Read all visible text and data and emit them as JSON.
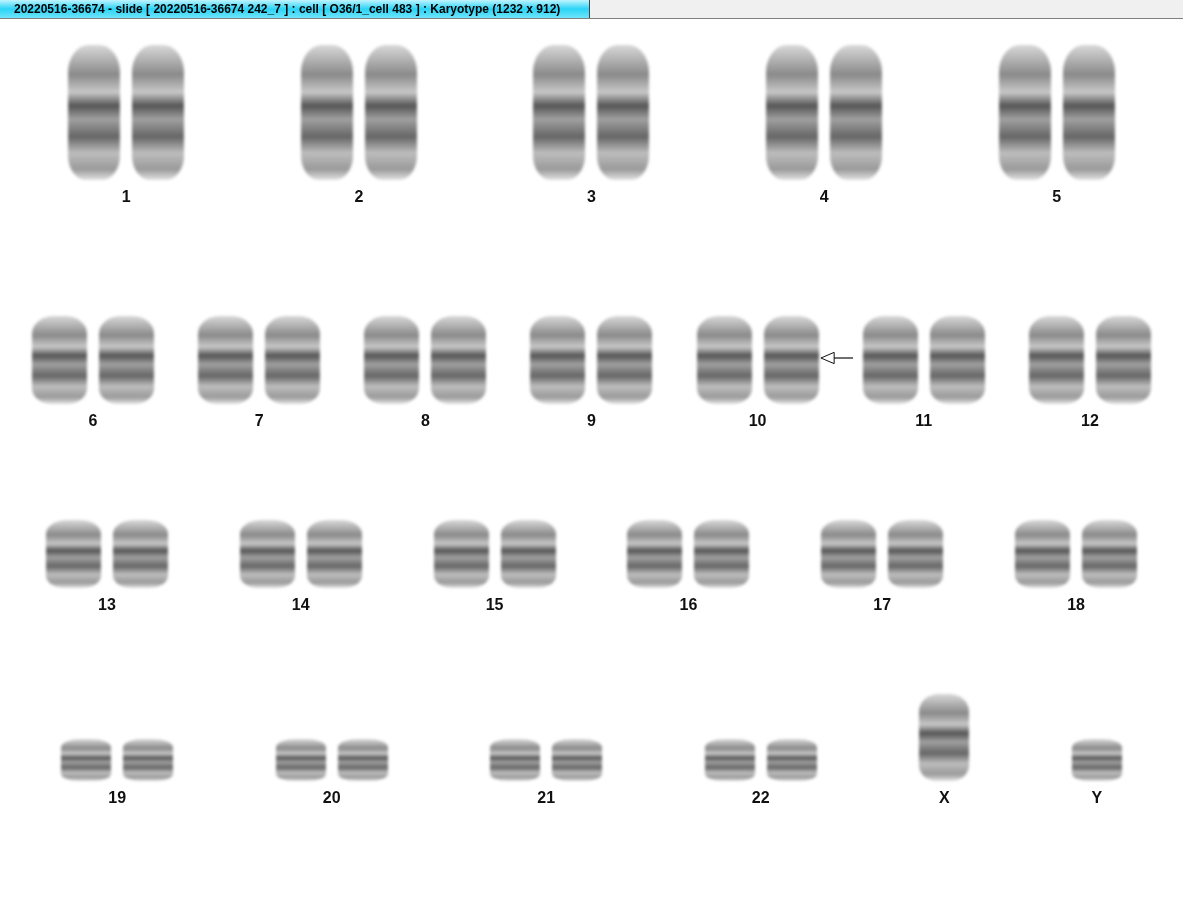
{
  "window": {
    "title": "20220516-36674 - slide [ 20220516-36674 242_7 ] : cell [ O36/1_cell 483 ] : Karyotype  (1232 x 912)"
  },
  "rows": [
    [
      {
        "label": "1",
        "kind": "pair",
        "marked": false
      },
      {
        "label": "2",
        "kind": "pair",
        "marked": false
      },
      {
        "label": "3",
        "kind": "pair",
        "marked": false
      },
      {
        "label": "4",
        "kind": "pair",
        "marked": false
      },
      {
        "label": "5",
        "kind": "pair",
        "marked": false
      }
    ],
    [
      {
        "label": "6",
        "kind": "pair",
        "marked": false
      },
      {
        "label": "7",
        "kind": "pair",
        "marked": false
      },
      {
        "label": "8",
        "kind": "pair",
        "marked": false
      },
      {
        "label": "9",
        "kind": "pair",
        "marked": false
      },
      {
        "label": "10",
        "kind": "pair",
        "marked": true
      },
      {
        "label": "11",
        "kind": "pair",
        "marked": false
      },
      {
        "label": "12",
        "kind": "pair",
        "marked": false
      }
    ],
    [
      {
        "label": "13",
        "kind": "pair",
        "marked": false
      },
      {
        "label": "14",
        "kind": "pair",
        "marked": false
      },
      {
        "label": "15",
        "kind": "pair",
        "marked": false
      },
      {
        "label": "16",
        "kind": "pair",
        "marked": false
      },
      {
        "label": "17",
        "kind": "pair",
        "marked": false
      },
      {
        "label": "18",
        "kind": "pair",
        "marked": false
      }
    ],
    [
      {
        "label": "19",
        "kind": "pair",
        "marked": false
      },
      {
        "label": "20",
        "kind": "pair",
        "marked": false
      },
      {
        "label": "21",
        "kind": "pair",
        "marked": false
      },
      {
        "label": "22",
        "kind": "pair",
        "marked": false
      },
      {
        "label": "X",
        "kind": "single",
        "marked": false
      },
      {
        "label": "Y",
        "kind": "single",
        "marked": false
      }
    ]
  ]
}
